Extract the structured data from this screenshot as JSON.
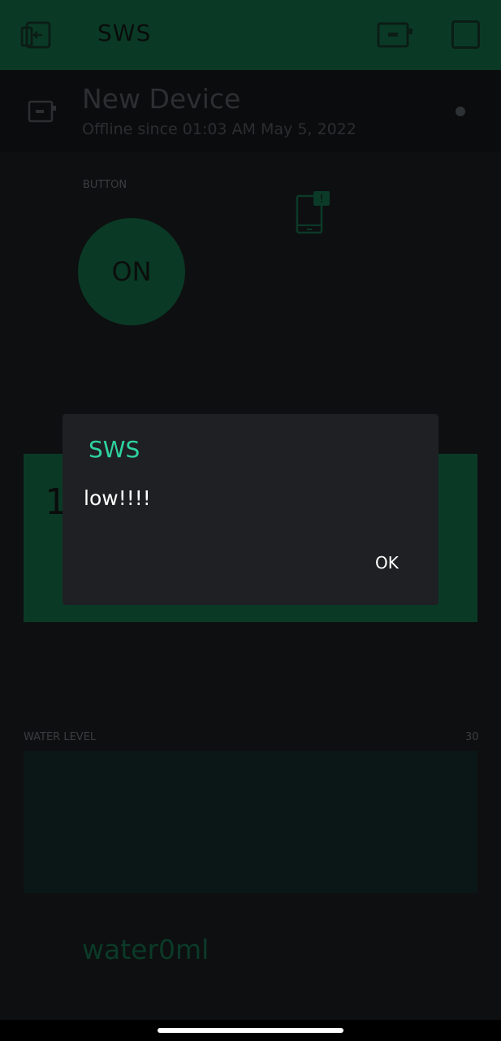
{
  "appbar": {
    "title": "SWS",
    "icons": [
      "exit-icon",
      "device-icon",
      "square-icon"
    ]
  },
  "device": {
    "name": "New Device",
    "status": "Offline since 01:03 AM May 5, 2022",
    "status_indicator": "offline"
  },
  "button_widget": {
    "label": "BUTTON",
    "state": "ON",
    "notification_icon": "phone-notification-icon"
  },
  "display_widget": {
    "value": "1"
  },
  "water_level": {
    "label": "WATER LEVEL",
    "max": "30",
    "value_text": "water0ml"
  },
  "dialog": {
    "title": "SWS",
    "message": "low!!!!",
    "ok_label": "OK"
  },
  "colors": {
    "accent": "#2ed3a0",
    "widget_green": "#0a3a26",
    "dialog_bg": "#1f2023",
    "background": "#0e0f10"
  }
}
